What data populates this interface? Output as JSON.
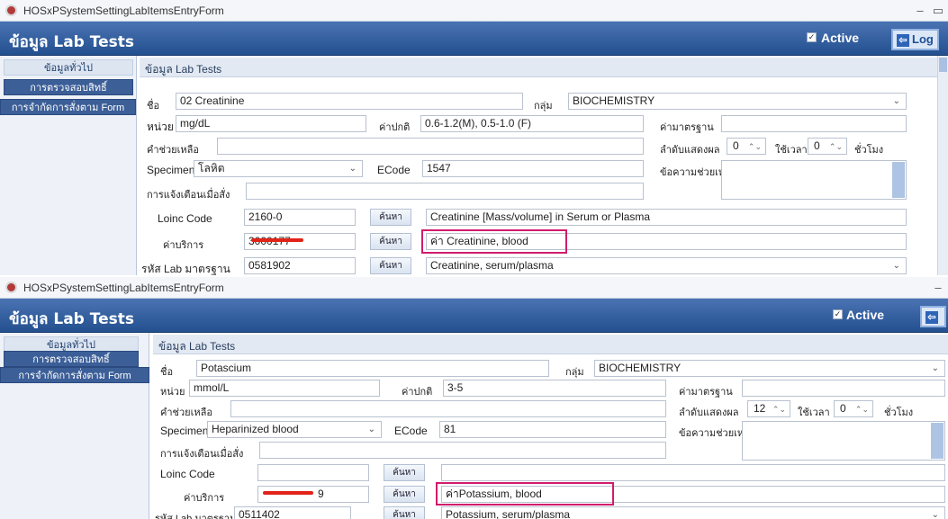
{
  "windows": [
    {
      "title": "HOSxPSystemSettingLabItemsEntryForm",
      "header_title": "ข้อมูล Lab Tests",
      "active_label": "Active",
      "log_label": "Log",
      "left_menu": [
        "ข้อมูลทั่วไป",
        "การตรวจสอบสิทธิ์",
        "การจำกัดการสั่งตาม Form"
      ],
      "tab_label": "ข้อมูล Lab Tests",
      "labels": {
        "name": "ชื่อ",
        "group": "กลุ่ม",
        "unit": "หน่วย",
        "normal": "ค่าปกติ",
        "standard": "ค่ามาตรฐาน",
        "help": "คำช่วยเหลือ",
        "display_order": "ลำดับแสดงผล",
        "use_time": "ใช้เวลา",
        "hours": "ชั่วโมง",
        "specimen": "Specimen",
        "ecode": "ECode",
        "help_message": "ข้อความช่วยเหลือ",
        "notify": "การแจ้งเตือนเมื่อสั่ง",
        "loinc": "Loinc Code",
        "service_price": "ค่าบริการ",
        "std_lab_code": "รหัส Lab มาตรฐาน",
        "search": "ค้นหา"
      },
      "values": {
        "name": "02 Creatinine",
        "group": "BIOCHEMISTRY",
        "unit": "mg/dL",
        "normal": "0.6-1.2(M), 0.5-1.0 (F)",
        "standard": "",
        "help": "",
        "display_order": "0",
        "use_time": "0",
        "specimen": "โลหิต",
        "ecode": "1547",
        "notify": "",
        "loinc": "2160-0",
        "loinc_desc": "Creatinine [Mass/volume] in Serum or Plasma",
        "service_code": "3000177",
        "service_desc": "ค่า Creatinine, blood",
        "std_lab_code": "0581902",
        "std_lab_desc": "Creatinine, serum/plasma"
      }
    },
    {
      "title": "HOSxPSystemSettingLabItemsEntryForm",
      "header_title": "ข้อมูล Lab Tests",
      "active_label": "Active",
      "log_label": "",
      "left_menu": [
        "ข้อมูลทั่วไป",
        "การตรวจสอบสิทธิ์",
        "การจำกัดการสั่งตาม Form"
      ],
      "tab_label": "ข้อมูล Lab Tests",
      "labels": {
        "name": "ชื่อ",
        "group": "กลุ่ม",
        "unit": "หน่วย",
        "normal": "ค่าปกติ",
        "standard": "ค่ามาตรฐาน",
        "help": "คำช่วยเหลือ",
        "display_order": "ลำดับแสดงผล",
        "use_time": "ใช้เวลา",
        "hours": "ชั่วโมง",
        "specimen": "Specimen",
        "ecode": "ECode",
        "help_message": "ข้อความช่วยเหลือ",
        "notify": "การแจ้งเตือนเมื่อสั่ง",
        "loinc": "Loinc Code",
        "service_price": "ค่าบริการ",
        "std_lab_code": "รหัส Lab มาตรฐาน",
        "search": "ค้นหา"
      },
      "values": {
        "name": "Potascium",
        "group": "BIOCHEMISTRY",
        "unit": "mmol/L",
        "normal": "3-5",
        "standard": "",
        "help": "",
        "display_order": "12",
        "use_time": "0",
        "specimen": "Heparinized blood",
        "ecode": "81",
        "notify": "",
        "loinc": "",
        "loinc_desc": "",
        "service_code": "9",
        "service_desc": "ค่าPotassium, blood",
        "std_lab_code": "0511402",
        "std_lab_desc": "Potassium, serum/plasma"
      }
    }
  ],
  "colors": {
    "header": "#23508f",
    "highlight": "#d21b6b",
    "redact": "#e2231a"
  },
  "icons": {
    "app": "app-logo-icon",
    "minimize": "minimize-icon",
    "maximize": "maximize-icon",
    "close": "close-icon",
    "log": "log-icon",
    "dropdown": "chevron-down-icon",
    "spinner": "spinner-icon"
  }
}
